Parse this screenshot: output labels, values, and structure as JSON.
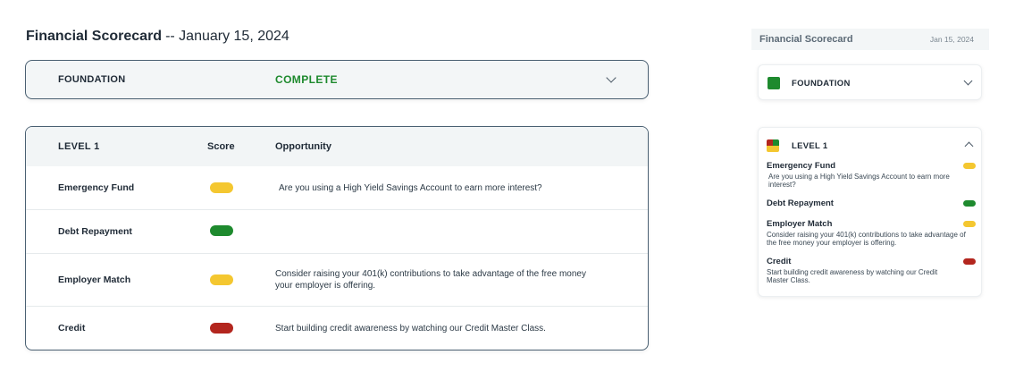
{
  "header": {
    "title_bold": "Financial Scorecard",
    "title_rest": "-- January 15, 2024"
  },
  "foundation": {
    "label": "FOUNDATION",
    "status": "COMPLETE",
    "status_color": "#1e8a2e"
  },
  "level1": {
    "label": "LEVEL 1",
    "score_header": "Score",
    "opportunity_header": "Opportunity",
    "rows": [
      {
        "name": "Emergency Fund",
        "score": "yellow",
        "opportunity": "Are you using a High Yield Savings Account to earn more interest?"
      },
      {
        "name": "Debt Repayment",
        "score": "green",
        "opportunity": ""
      },
      {
        "name": "Employer Match",
        "score": "yellow",
        "opportunity": "Consider raising your 401(k) contributions to take advantage of the free money your employer is offering."
      },
      {
        "name": "Credit",
        "score": "red",
        "opportunity": "Start building credit awareness by watching our Credit Master Class."
      }
    ]
  },
  "sidebar": {
    "title": "Financial Scorecard",
    "date": "Jan 15, 2024",
    "foundation_label": "FOUNDATION",
    "level_label": "LEVEL 1",
    "items": [
      {
        "name": "Emergency Fund",
        "score": "yellow",
        "opportunity": "Are you using a High Yield Savings Account to earn more interest?"
      },
      {
        "name": "Debt Repayment",
        "score": "green",
        "opportunity": ""
      },
      {
        "name": "Employer Match",
        "score": "yellow",
        "opportunity": "Consider raising your 401(k) contributions to take advantage of the free money your employer is offering."
      },
      {
        "name": "Credit",
        "score": "red",
        "opportunity": "Start building credit awareness by watching our Credit Master Class."
      }
    ]
  },
  "colors": {
    "green": "#1e8a2e",
    "yellow": "#f4c730",
    "red": "#b3261e",
    "border": "#4a6072"
  },
  "icons": {
    "expand": "chevron-down-icon",
    "collapse": "chevron-up-icon"
  }
}
